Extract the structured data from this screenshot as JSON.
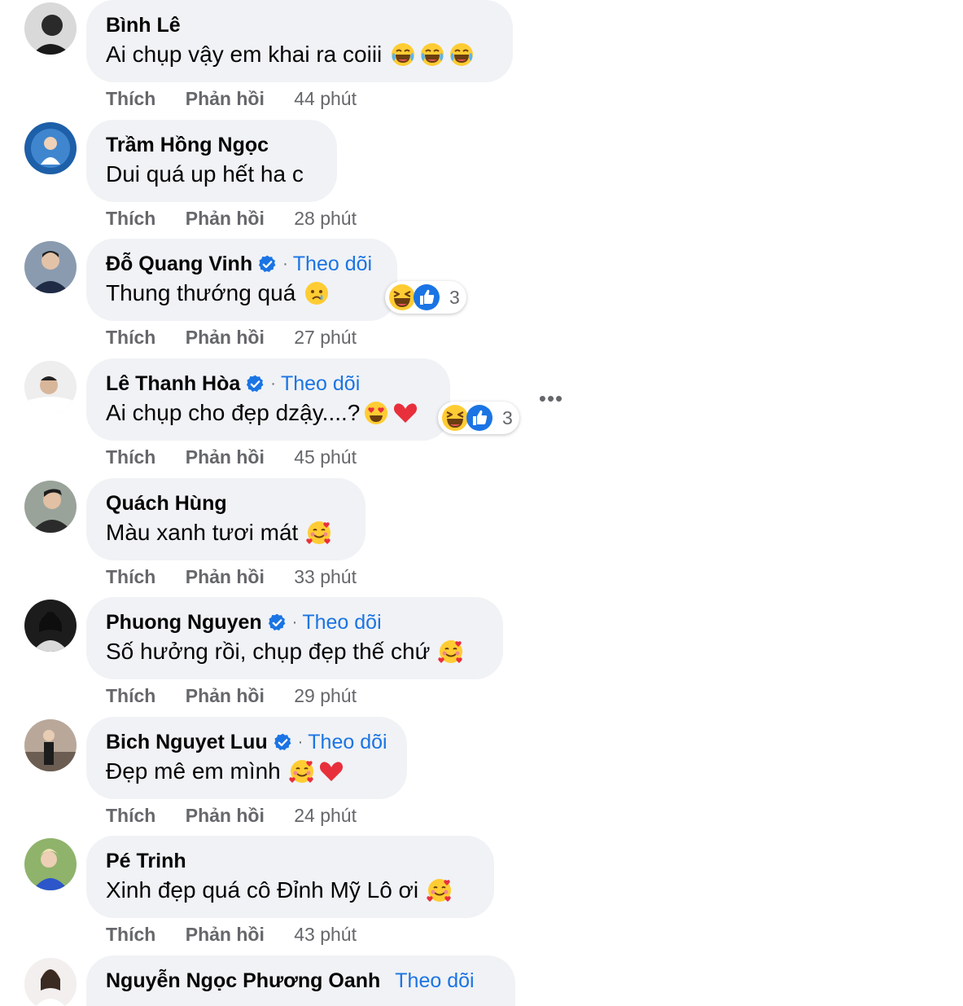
{
  "comments": [
    {
      "name": "Bình Lê",
      "verified": false,
      "follow": "",
      "text": "Ai chụp vậy em khai ra coiii",
      "like": "Thích",
      "reply": "Phản hồi",
      "time": "44 phút"
    },
    {
      "name": "Trầm Hồng Ngọc",
      "verified": false,
      "follow": "",
      "text": "Dui quá up hết ha c",
      "like": "Thích",
      "reply": "Phản hồi",
      "time": "28 phút"
    },
    {
      "name": "Đỗ Quang Vinh",
      "verified": true,
      "follow": "Theo dõi",
      "text": "Thung thướng quá",
      "like": "Thích",
      "reply": "Phản hồi",
      "time": "27 phút",
      "reaction_count": "3"
    },
    {
      "name": "Lê Thanh Hòa",
      "verified": true,
      "follow": "Theo dõi",
      "text": "Ai chụp cho đẹp dzậy....?",
      "like": "Thích",
      "reply": "Phản hồi",
      "time": "45 phút",
      "reaction_count": "3"
    },
    {
      "name": "Quách Hùng",
      "verified": false,
      "follow": "",
      "text": "Màu xanh tươi mát",
      "like": "Thích",
      "reply": "Phản hồi",
      "time": "33 phút"
    },
    {
      "name": "Phuong Nguyen",
      "verified": true,
      "follow": "Theo dõi",
      "text": "Số hưởng rồi, chụp đẹp thế chứ",
      "like": "Thích",
      "reply": "Phản hồi",
      "time": "29 phút"
    },
    {
      "name": "Bich Nguyet Luu",
      "verified": true,
      "follow": "Theo dõi",
      "text": "Đẹp mê em mình",
      "like": "Thích",
      "reply": "Phản hồi",
      "time": "24 phút"
    },
    {
      "name": "Pé Trinh",
      "verified": false,
      "follow": "",
      "text": "Xinh đẹp quá cô Đỉnh Mỹ Lô ơi",
      "like": "Thích",
      "reply": "Phản hồi",
      "time": "43 phút"
    },
    {
      "name": "Nguyễn Ngọc Phương Oanh",
      "verified": false,
      "follow": "Theo dõi",
      "text": "",
      "like": "",
      "reply": "",
      "time": ""
    }
  ],
  "dot": "·",
  "more_label": "•••",
  "colors": {
    "bubble": "#f0f2f5",
    "link": "#1b74e4",
    "muted": "#65676b",
    "verified": "#1b74e4"
  },
  "icons": {
    "verified": "verified-badge-icon",
    "laugh": "laughing-emoji-icon",
    "heart": "heart-icon",
    "like": "like-reaction-icon",
    "haha": "haha-reaction-icon",
    "sad": "sad-emoji-icon",
    "love_face": "smiling-hearts-emoji-icon",
    "heart_eyes": "heart-eyes-emoji-icon"
  }
}
